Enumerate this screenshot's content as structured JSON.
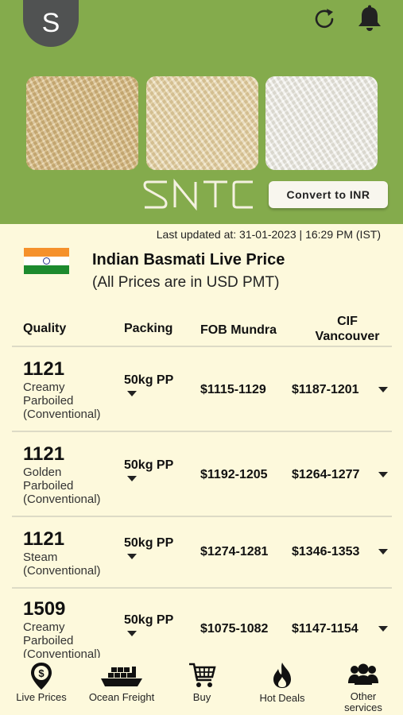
{
  "header": {
    "avatar_letter": "S",
    "logo_text": "SNTC",
    "convert_button": "Convert to INR",
    "icons": [
      "refresh-icon",
      "bell-icon"
    ]
  },
  "price_panel": {
    "last_updated": "Last updated at: 31-01-2023 | 16:29 PM (IST)",
    "title": "Indian Basmati Live Price",
    "subtitle": "(All Prices are in USD PMT)"
  },
  "table": {
    "headers": {
      "quality": "Quality",
      "packing": "Packing",
      "fob": "FOB Mundra",
      "cif_line1": "CIF",
      "cif_line2": "Vancouver"
    },
    "rows": [
      {
        "grade": "1121",
        "desc1": "Creamy",
        "desc2": "Parboiled",
        "desc3": "(Conventional)",
        "packing": "50kg PP",
        "fob": "$1115-1129",
        "cif": "$1187-1201"
      },
      {
        "grade": "1121",
        "desc1": "Golden",
        "desc2": "Parboiled",
        "desc3": "(Conventional)",
        "packing": "50kg PP",
        "fob": "$1192-1205",
        "cif": "$1264-1277"
      },
      {
        "grade": "1121",
        "desc1": "Steam",
        "desc2": "(Conventional)",
        "desc3": "",
        "packing": "50kg PP",
        "fob": "$1274-1281",
        "cif": "$1346-1353"
      },
      {
        "grade": "1509",
        "desc1": "Creamy",
        "desc2": "Parboiled",
        "desc3": "(Conventional)",
        "packing": "50kg PP",
        "fob": "$1075-1082",
        "cif": "$1147-1154"
      }
    ]
  },
  "nav": {
    "items": [
      {
        "label": "Live Prices",
        "icon": "dollar-pin-icon"
      },
      {
        "label": "Ocean Freight",
        "icon": "ship-icon"
      },
      {
        "label": "Buy",
        "icon": "cart-icon"
      },
      {
        "label": "Hot Deals",
        "icon": "fire-icon"
      },
      {
        "label": "Other services",
        "label1": "Other",
        "label2": "services",
        "icon": "people-icon"
      }
    ]
  },
  "colors": {
    "header_bg": "#84ab4c",
    "page_bg": "#fdf9dc",
    "avatar_bg": "#505252"
  }
}
